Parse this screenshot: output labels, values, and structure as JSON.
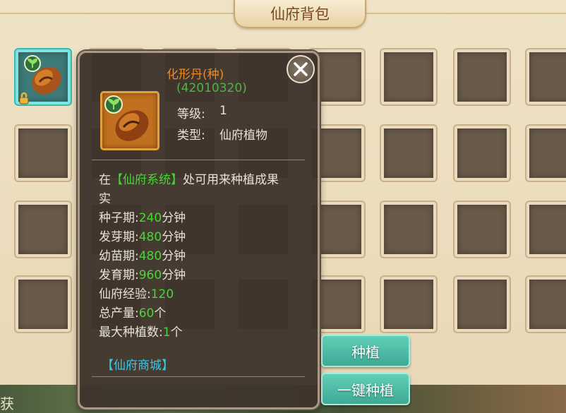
{
  "window": {
    "title": "仙府背包"
  },
  "item": {
    "name": "化形丹(种)",
    "code": "(42010320)",
    "level_label": "等级:",
    "level_value": "1",
    "type_label": "类型:",
    "type_value": "仙府植物",
    "desc_prefix": "在",
    "desc_link": "【仙府系统】",
    "desc_suffix": "处可用来种植成果",
    "desc_line2": "实",
    "stats": [
      {
        "label": "种子期:",
        "value": "240",
        "unit": "分钟"
      },
      {
        "label": "发芽期:",
        "value": "480",
        "unit": "分钟"
      },
      {
        "label": "幼苗期:",
        "value": "480",
        "unit": "分钟"
      },
      {
        "label": "发育期:",
        "value": "960",
        "unit": "分钟"
      },
      {
        "label": "仙府经验:",
        "value": "120",
        "unit": ""
      },
      {
        "label": "总产量:",
        "value": "60",
        "unit": "个"
      },
      {
        "label": "最大种植数:",
        "value": "1",
        "unit": "个"
      }
    ],
    "shop_link": "【仙府商城】"
  },
  "buttons": {
    "plant": "种植",
    "plant_all": "一键种植"
  },
  "bottom_text": "获",
  "colors": {
    "item_name": "#f08a1c",
    "stat_value": "#46d636",
    "link": "#38c8e8",
    "button": "#4dbda6"
  },
  "icons": [
    "seed-item-icon",
    "lock-icon",
    "close-icon",
    "sprout-icon"
  ]
}
